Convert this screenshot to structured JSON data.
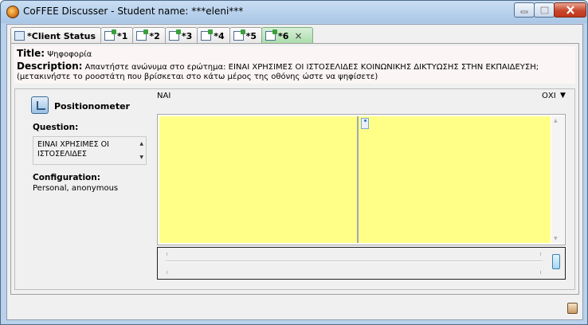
{
  "window": {
    "title": "CoFFEE Discusser - Student name: ***eleni***",
    "icons": {
      "app": "coffee-app-icon",
      "minimize": "minimize-icon",
      "maximize": "maximize-icon",
      "close": "close-icon"
    }
  },
  "tabs": [
    {
      "label": "*Client Status",
      "icon": "monitor-icon"
    },
    {
      "label": "*1",
      "icon": "edit-note-icon"
    },
    {
      "label": "*2",
      "icon": "edit-note-icon"
    },
    {
      "label": "*3",
      "icon": "edit-note-icon"
    },
    {
      "label": "*4",
      "icon": "edit-note-icon"
    },
    {
      "label": "*5",
      "icon": "edit-note-icon"
    },
    {
      "label": "*6",
      "icon": "edit-note-icon",
      "active": true,
      "close": "×"
    }
  ],
  "info": {
    "title_label": "Title:",
    "title_value": "Ψηφοφορία",
    "description_label": "Description:",
    "description_value": "Απαντήστε ανώνυμα στο ερώτημα: ΕΙΝΑΙ ΧΡΗΣΙΜΕΣ ΟΙ ΙΣΤΟΣΕΛΙΔΕΣ ΚΟΙΝΩΝΙΚΗΣ ΔΙΚΤΥΩΣΗΣ ΣΤΗΝ ΕΚΠΑΙΔΕΥΣΗ;",
    "description_line2": "(μετακινήστε το ροοστάτη που βρίσκεται στο κάτω μέρος της οθόνης ώστε να ψηφίσετε)"
  },
  "tool": {
    "name": "Positionometer",
    "icon": "positionometer-icon",
    "question_label": "Question:",
    "question_text": "ΕΙΝΑΙ ΧΡΗΣΙΜΕΣ ΟΙ ΙΣΤΟΣΕΛΙΔΕΣ",
    "configuration_label": "Configuration:",
    "configuration_value": "Personal, anonymous"
  },
  "positionometer": {
    "left_label": "ΝΑΙ",
    "right_label": "ΟΧΙ",
    "slider_value": 1.0,
    "colors": {
      "area": "#ffff88",
      "divider": "#9fa8b8"
    }
  },
  "glyphs": {
    "up": "▲",
    "down": "▼",
    "menu": "▼",
    "close_tab": "×"
  }
}
